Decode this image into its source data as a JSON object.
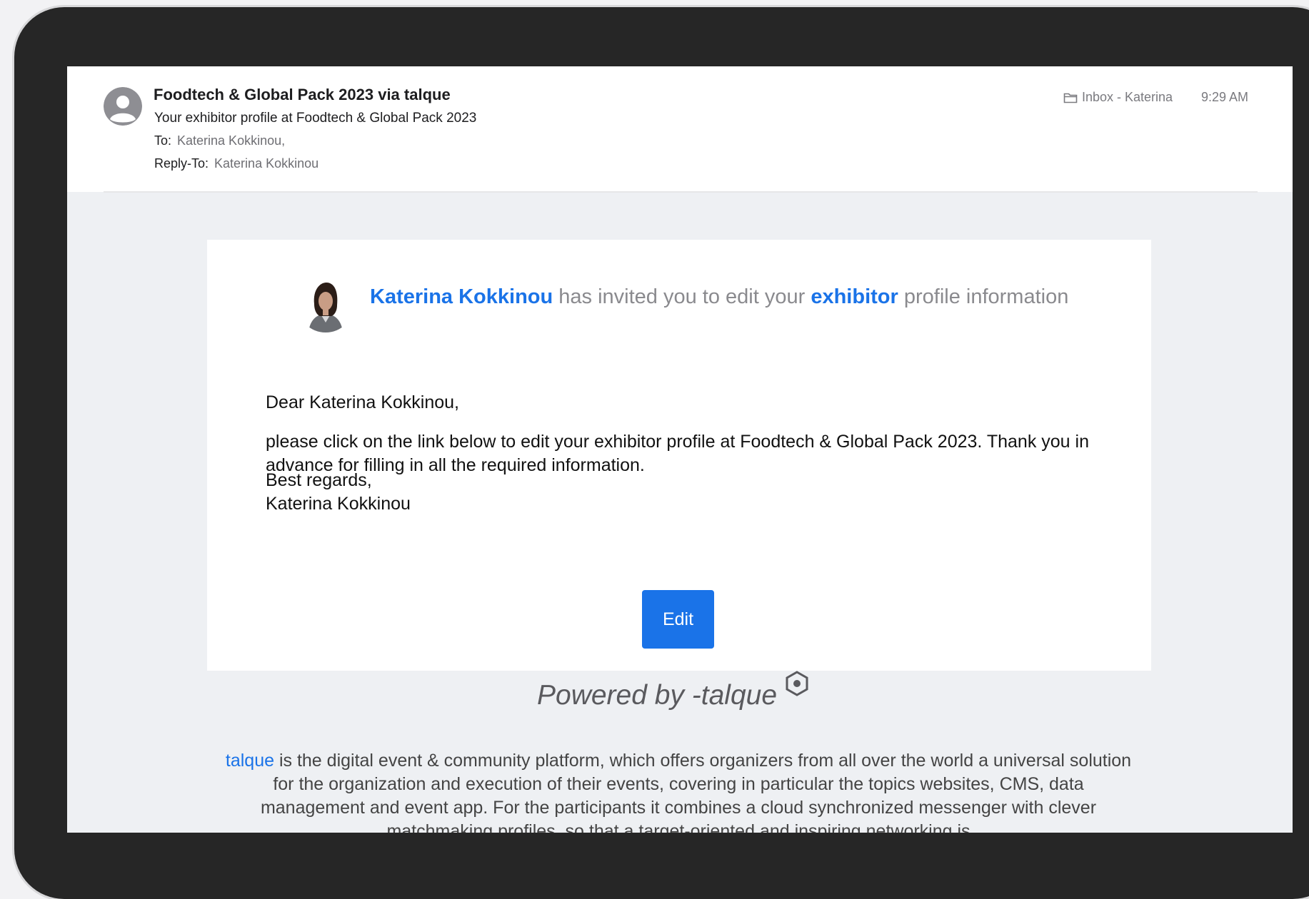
{
  "email": {
    "sender": "Foodtech & Global Pack 2023 via talque",
    "subject": "Your exhibitor profile at Foodtech & Global Pack 2023",
    "to_label": "To:",
    "to_value": "Katerina Kokkinou,",
    "reply_to_label": "Reply-To:",
    "reply_to_value": "Katerina Kokkinou",
    "mailbox": "Inbox - Katerina",
    "time": "9:29 AM"
  },
  "body": {
    "inviter_name": "Katerina Kokkinou",
    "invite_mid": " has invited you to edit your ",
    "invite_role": "exhibitor",
    "invite_end": " profile information",
    "greeting": "Dear Katerina Kokkinou,",
    "paragraph": "please click on the link below to edit your exhibitor profile at Foodtech & Global Pack 2023. Thank you in advance for filling in all the required information.",
    "closing": "Best regards,",
    "signature": "Katerina Kokkinou",
    "edit_button": "Edit"
  },
  "footer": {
    "powered_by": "Powered by -talque",
    "brand": "talque",
    "description": " is the digital event & community platform, which offers organizers from all over the world a universal solution for the organization and execution of their events, covering in particular the topics websites, CMS, data management and event app. For the participants it combines a cloud synchronized messenger with clever matchmaking profiles, so that a target-oriented and inspiring networking is"
  },
  "colors": {
    "accent": "#1a73e8",
    "bezel": "#262626",
    "canvas": "#eef0f3"
  },
  "icons": {
    "sender_avatar": "person-avatar-icon",
    "mailbox": "folder-icon",
    "talque_logo": "talque-logo-icon"
  }
}
